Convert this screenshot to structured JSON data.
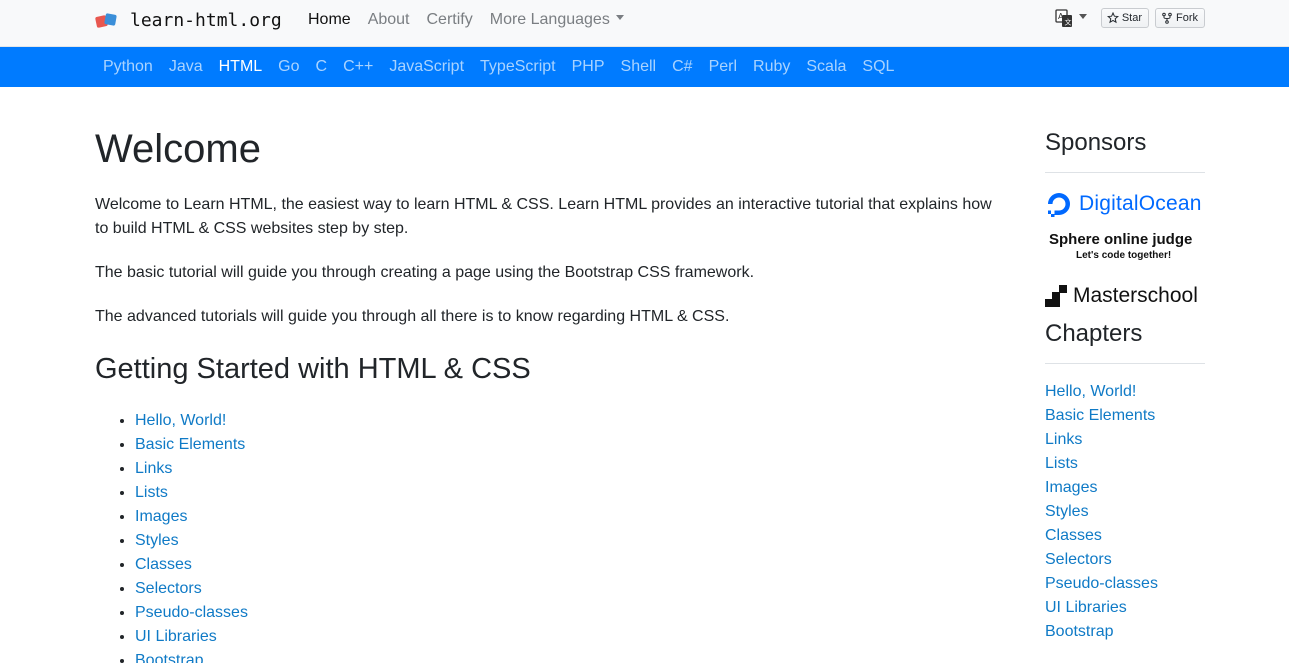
{
  "brand": {
    "name": "learn-html.org",
    "logo": "learn-html-logo"
  },
  "topnav": {
    "items": [
      "Home",
      "About",
      "Certify"
    ],
    "more": "More Languages",
    "translate_icon": "translate-icon",
    "github_star": "Star",
    "github_fork": "Fork"
  },
  "languages": [
    "Python",
    "Java",
    "HTML",
    "Go",
    "C",
    "C++",
    "JavaScript",
    "TypeScript",
    "PHP",
    "Shell",
    "C#",
    "Perl",
    "Ruby",
    "Scala",
    "SQL"
  ],
  "active_language": "HTML",
  "main": {
    "title": "Welcome",
    "paragraphs": [
      "Welcome to Learn HTML, the easiest way to learn HTML & CSS. Learn HTML provides an interactive tutorial that explains how to build HTML & CSS websites step by step.",
      "The basic tutorial will guide you through creating a page using the Bootstrap CSS framework.",
      "The advanced tutorials will guide you through all there is to know regarding HTML & CSS."
    ],
    "section_title": "Getting Started with HTML & CSS",
    "chapters": [
      "Hello, World!",
      "Basic Elements",
      "Links",
      "Lists",
      "Images",
      "Styles",
      "Classes",
      "Selectors",
      "Pseudo-classes",
      "UI Libraries",
      "Bootstrap"
    ]
  },
  "sidebar": {
    "sponsors_title": "Sponsors",
    "sponsors": {
      "digitalocean": "DigitalOcean",
      "soj_title": "Sphere online judge",
      "soj_sub": "Let's code together!",
      "masterschool": "Masterschool"
    },
    "chapters_title": "Chapters",
    "chapters": [
      "Hello, World!",
      "Basic Elements",
      "Links",
      "Lists",
      "Images",
      "Styles",
      "Classes",
      "Selectors",
      "Pseudo-classes",
      "UI Libraries",
      "Bootstrap"
    ]
  },
  "colors": {
    "accent": "#007bff",
    "link": "#0f7ac6",
    "navbar_bg": "#f8f9fa",
    "digitalocean": "#0069ff"
  }
}
